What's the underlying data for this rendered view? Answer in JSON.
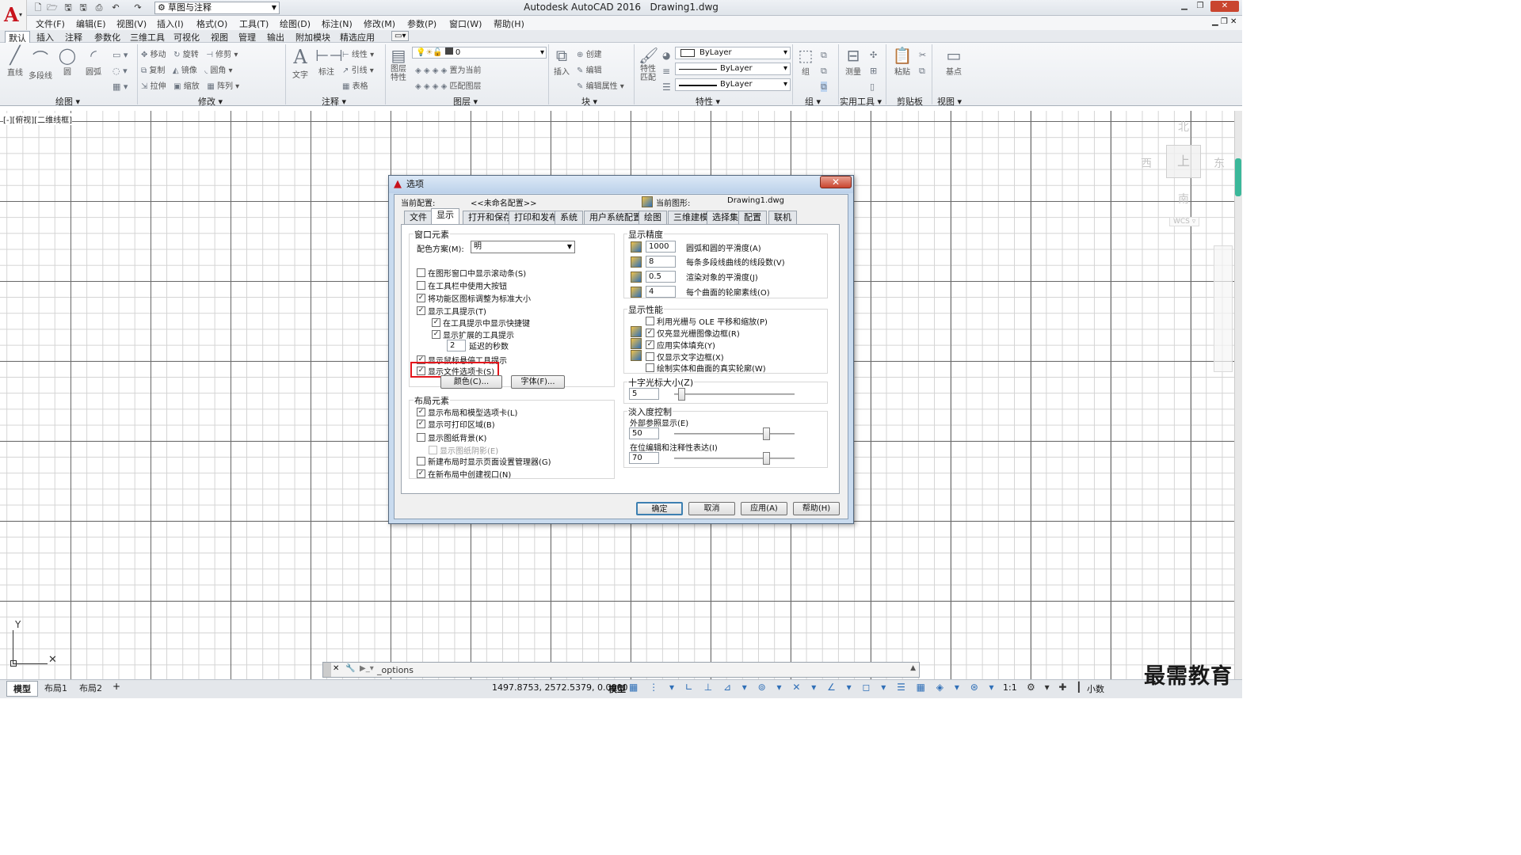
{
  "app": {
    "name": "Autodesk AutoCAD 2016",
    "file": "Drawing1.dwg",
    "workspace": "草图与注释"
  },
  "menu": [
    "文件(F)",
    "编辑(E)",
    "视图(V)",
    "插入(I)",
    "格式(O)",
    "工具(T)",
    "绘图(D)",
    "标注(N)",
    "修改(M)",
    "参数(P)",
    "窗口(W)",
    "帮助(H)"
  ],
  "ribbon_tabs": [
    "默认",
    "插入",
    "注释",
    "参数化",
    "三维工具",
    "可视化",
    "视图",
    "管理",
    "输出",
    "附加模块",
    "精选应用"
  ],
  "ribbon": {
    "draw": {
      "label": "绘图",
      "items": [
        "直线",
        "多段线",
        "圆",
        "圆弧"
      ]
    },
    "modify": {
      "label": "修改",
      "items": [
        "移动",
        "旋转",
        "修剪",
        "复制",
        "镜像",
        "圆角",
        "拉伸",
        "缩放",
        "阵列"
      ]
    },
    "annotation": {
      "label": "注释",
      "items": [
        "文字",
        "标注",
        "线性",
        "引线",
        "表格"
      ]
    },
    "layers": {
      "label": "图层",
      "items": [
        "图层特性",
        "置为当前",
        "匹配图层"
      ],
      "current_layer": "0"
    },
    "block": {
      "label": "块",
      "items": [
        "插入",
        "创建",
        "编辑",
        "编辑属性"
      ]
    },
    "properties": {
      "label": "特性",
      "items": [
        "特性匹配"
      ],
      "color": "ByLayer",
      "linetype": "ByLayer",
      "lineweight": "ByLayer"
    },
    "groups": {
      "label": "组",
      "items": [
        "组"
      ]
    },
    "utilities": {
      "label": "实用工具",
      "items": [
        "测量"
      ]
    },
    "clipboard": {
      "label": "剪贴板",
      "items": [
        "粘贴"
      ]
    },
    "view": {
      "label": "视图",
      "items": [
        "基点"
      ]
    }
  },
  "viewport_label": "[-][俯视][二维线框]",
  "viewcube": {
    "n": "北",
    "s": "南",
    "e": "东",
    "w": "西",
    "top": "上",
    "wcs": "WCS"
  },
  "dialog": {
    "title": "选项",
    "current_profile_label": "当前配置:",
    "current_profile": "<<未命名配置>>",
    "current_drawing_label": "当前图形:",
    "current_drawing": "Drawing1.dwg",
    "tabs": [
      "文件",
      "显示",
      "打开和保存",
      "打印和发布",
      "系统",
      "用户系统配置",
      "绘图",
      "三维建模",
      "选择集",
      "配置",
      "联机"
    ],
    "window_elements": {
      "title": "窗口元素",
      "color_scheme_label": "配色方案(M):",
      "color_scheme_value": "明",
      "checkboxes": [
        {
          "label": "在图形窗口中显示滚动条(S)",
          "checked": false
        },
        {
          "label": "在工具栏中使用大按钮",
          "checked": false
        },
        {
          "label": "将功能区图标调整为标准大小",
          "checked": true
        },
        {
          "label": "显示工具提示(T)",
          "checked": true
        },
        {
          "label": "在工具提示中显示快捷键",
          "checked": true
        },
        {
          "label": "显示扩展的工具提示",
          "checked": true
        },
        {
          "label": "显示鼠标悬停工具提示",
          "checked": true
        },
        {
          "label": "显示文件选项卡(S)",
          "checked": true
        }
      ],
      "delay_value": "2",
      "delay_label": "延迟的秒数",
      "colors_button": "颜色(C)...",
      "fonts_button": "字体(F)..."
    },
    "layout_elements": {
      "title": "布局元素",
      "checkboxes": [
        {
          "label": "显示布局和模型选项卡(L)",
          "checked": true
        },
        {
          "label": "显示可打印区域(B)",
          "checked": true
        },
        {
          "label": "显示图纸背景(K)",
          "checked": false
        },
        {
          "label": "显示图纸阴影(E)",
          "checked": false,
          "disabled": true
        },
        {
          "label": "新建布局时显示页面设置管理器(G)",
          "checked": false
        },
        {
          "label": "在新布局中创建视口(N)",
          "checked": true
        }
      ]
    },
    "display_resolution": {
      "title": "显示精度",
      "rows": [
        {
          "value": "1000",
          "label": "圆弧和圆的平滑度(A)"
        },
        {
          "value": "8",
          "label": "每条多段线曲线的线段数(V)"
        },
        {
          "value": "0.5",
          "label": "渲染对象的平滑度(J)"
        },
        {
          "value": "4",
          "label": "每个曲面的轮廓素线(O)"
        }
      ]
    },
    "display_performance": {
      "title": "显示性能",
      "checkboxes": [
        {
          "label": "利用光栅与 OLE 平移和缩放(P)",
          "checked": false
        },
        {
          "label": "仅亮显光栅图像边框(R)",
          "checked": true
        },
        {
          "label": "应用实体填充(Y)",
          "checked": true
        },
        {
          "label": "仅显示文字边框(X)",
          "checked": false
        },
        {
          "label": "绘制实体和曲面的真实轮廓(W)",
          "checked": false
        }
      ]
    },
    "crosshair": {
      "title": "十字光标大小(Z)",
      "value": "5",
      "fraction": 0.05
    },
    "fade": {
      "title": "淡入度控制",
      "xref_label": "外部参照显示(E)",
      "xref_value": "50",
      "xref_fraction": 0.5,
      "inplace_label": "在位编辑和注释性表达(I)",
      "inplace_value": "70",
      "inplace_fraction": 0.7
    },
    "buttons": {
      "ok": "确定",
      "cancel": "取消",
      "apply": "应用(A)",
      "help": "帮助(H)"
    }
  },
  "command_line": "_options",
  "layout_tabs": [
    "模型",
    "布局1",
    "布局2"
  ],
  "status": {
    "coords": "1497.8753, 2572.5379, 0.0000",
    "mode": "模型",
    "scale": "1:1",
    "units": "小数"
  },
  "watermark": "最需教育",
  "colors": {
    "accent": "#c8131c",
    "highlight": "#e3161c",
    "grid_major": "#6a6a6a",
    "grid_minor": "#d4d4d4"
  }
}
